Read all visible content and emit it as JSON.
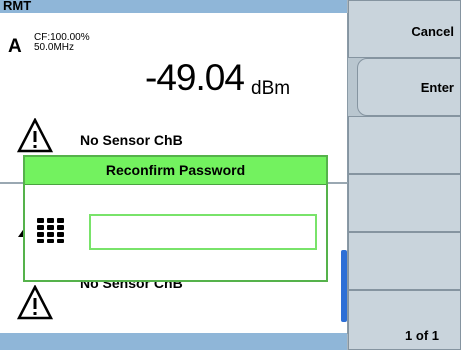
{
  "status_bar": {
    "label": "RMT"
  },
  "measurement": {
    "channel": "A",
    "cf": "CF:100.00%",
    "frequency": "50.0MHz",
    "reading": "-49.04",
    "unit": "dBm"
  },
  "warnings": {
    "upper": "No Sensor ChB",
    "lower": "No Sensor ChB"
  },
  "dialog": {
    "title": "Reconfirm Password",
    "password_value": ""
  },
  "softkeys": {
    "cancel": "Cancel",
    "enter": "Enter",
    "page": "1 of 1"
  },
  "colors": {
    "status_bar": "#8fb6d8",
    "dialog_title": "#73f25f",
    "dialog_border": "#55b24b",
    "scrollbar": "#2d6fd6"
  },
  "icons": [
    "warning-triangle-icon",
    "keypad-icon"
  ]
}
